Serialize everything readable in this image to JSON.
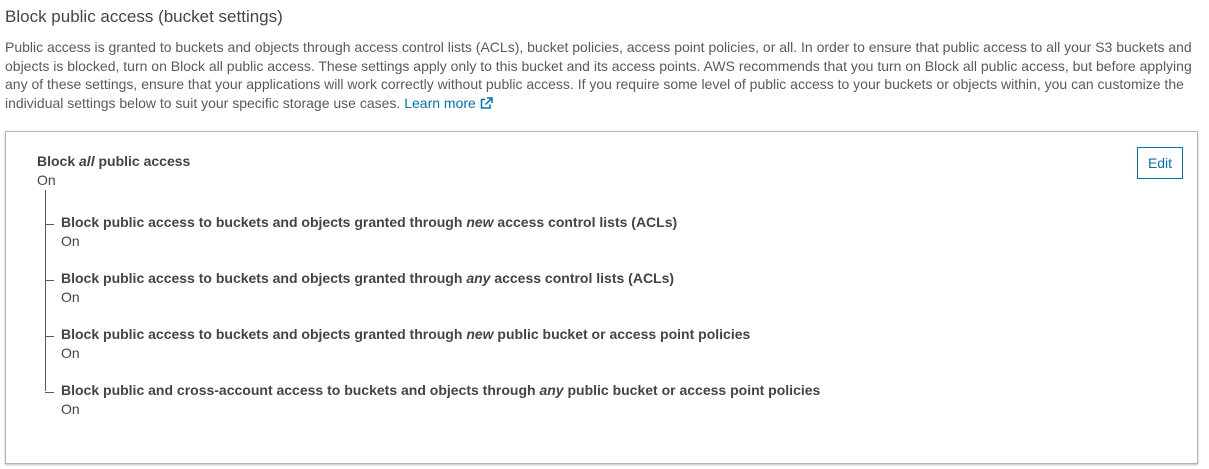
{
  "section": {
    "title": "Block public access (bucket settings)",
    "description": "Public access is granted to buckets and objects through access control lists (ACLs), bucket policies, access point policies, or all. In order to ensure that public access to all your S3 buckets and objects is blocked, turn on Block all public access. These settings apply only to this bucket and its access points. AWS recommends that you turn on Block all public access, but before applying any of these settings, ensure that your applications will work correctly without public access. If you require some level of public access to your buckets or objects within, you can customize the individual settings below to suit your specific storage use cases.",
    "learn_more": "Learn more"
  },
  "panel": {
    "edit_label": "Edit",
    "main": {
      "label_prefix": "Block ",
      "label_em": "all",
      "label_suffix": " public access",
      "value": "On"
    },
    "settings": [
      {
        "prefix": "Block public access to buckets and objects granted through ",
        "em": "new",
        "suffix": " access control lists (ACLs)",
        "value": "On"
      },
      {
        "prefix": "Block public access to buckets and objects granted through ",
        "em": "any",
        "suffix": " access control lists (ACLs)",
        "value": "On"
      },
      {
        "prefix": "Block public access to buckets and objects granted through ",
        "em": "new",
        "suffix": " public bucket or access point policies",
        "value": "On"
      },
      {
        "prefix": "Block public and cross-account access to buckets and objects through ",
        "em": "any",
        "suffix": " public bucket or access point policies",
        "value": "On"
      }
    ]
  },
  "colors": {
    "link": "#0073bb",
    "text": "#444444",
    "border": "#aab7b8"
  },
  "icons": {
    "learn_more": "external-link-icon"
  }
}
